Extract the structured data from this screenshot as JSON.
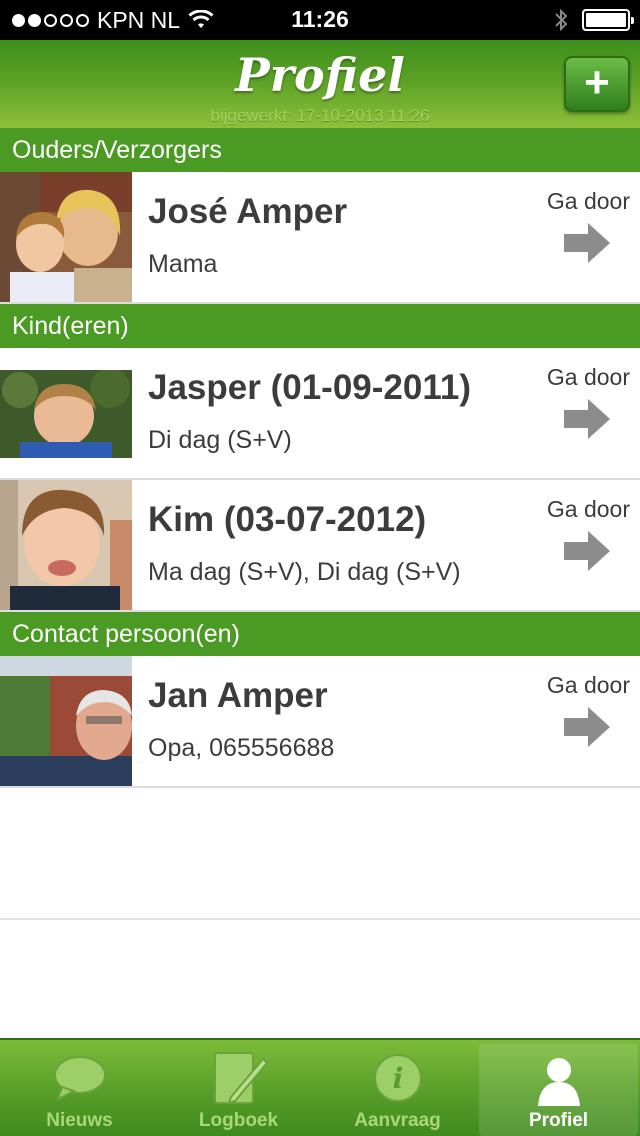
{
  "status_bar": {
    "carrier": "KPN NL",
    "time": "11:26",
    "signal_dots_filled": 2,
    "signal_dots_total": 5
  },
  "header": {
    "title": "Profiel",
    "updated": "bijgewerkt: 17-10-2013 11:26",
    "add_label": "+"
  },
  "sections": {
    "parents": "Ouders/Verzorgers",
    "children": "Kind(eren)",
    "contacts": "Contact persoon(en)"
  },
  "people": [
    {
      "name": "José Amper",
      "detail": "Mama",
      "action": "Ga door"
    },
    {
      "name": "Jasper (01-09-2011)",
      "detail": "Di dag (S+V)",
      "action": "Ga door"
    },
    {
      "name": "Kim (03-07-2012)",
      "detail": "Ma dag (S+V), Di dag (S+V)",
      "action": "Ga door"
    },
    {
      "name": "Jan Amper",
      "detail": "Opa, 065556688",
      "action": "Ga door"
    }
  ],
  "tabs": [
    {
      "label": "Nieuws",
      "icon": "speech-bubble-icon"
    },
    {
      "label": "Logboek",
      "icon": "notepad-pencil-icon"
    },
    {
      "label": "Aanvraag",
      "icon": "info-icon"
    },
    {
      "label": "Profiel",
      "icon": "person-icon",
      "active": true
    }
  ],
  "colors": {
    "header_green": "#5ba126",
    "section_green": "#4b9a23",
    "arrow_gray": "#8c8c8c"
  }
}
